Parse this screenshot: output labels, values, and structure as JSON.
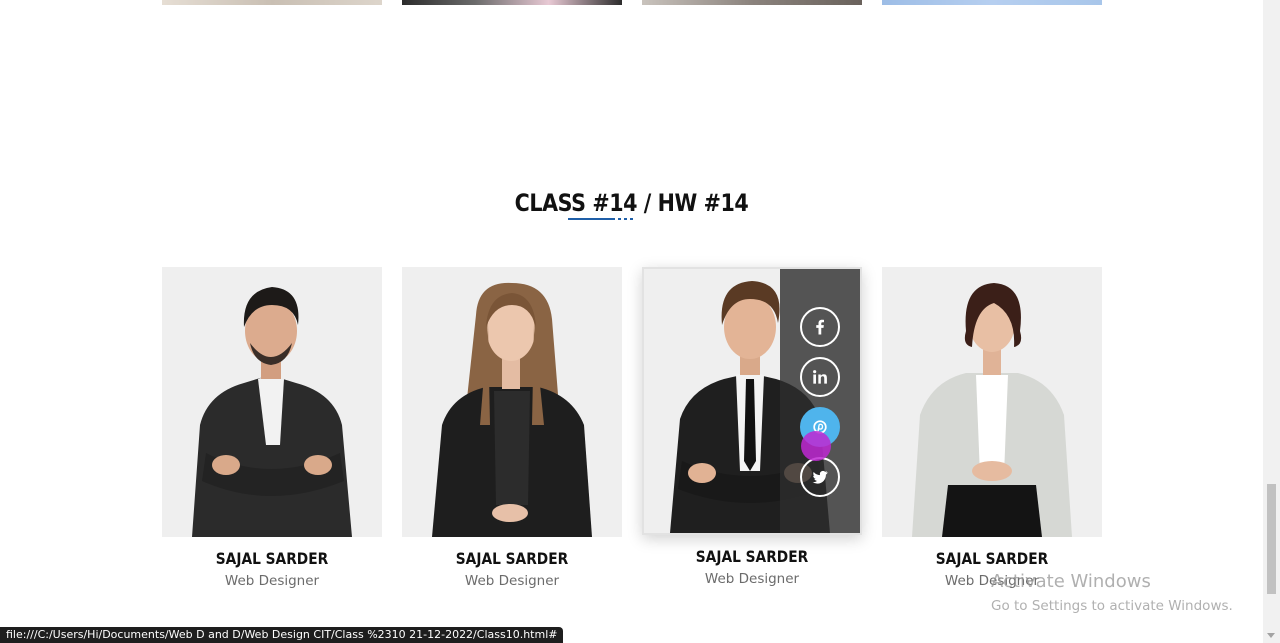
{
  "top_gallery": {
    "thumbs": [
      {
        "color": "#d8d0c6"
      },
      {
        "color": "#3a3a3a"
      },
      {
        "color": "#8a827c"
      },
      {
        "color": "#a8c6ea"
      }
    ]
  },
  "section": {
    "title": "CLASS #14 / HW #14"
  },
  "team": [
    {
      "name": "SAJAL SARDER",
      "role": "Web Designer"
    },
    {
      "name": "SAJAL SARDER",
      "role": "Web Designer"
    },
    {
      "name": "SAJAL SARDER",
      "role": "Web Designer"
    },
    {
      "name": "SAJAL SARDER",
      "role": "Web Designer"
    }
  ],
  "social": {
    "buttons": [
      {
        "icon": "facebook-icon"
      },
      {
        "icon": "linkedin-icon"
      },
      {
        "icon": "pinterest-icon"
      },
      {
        "icon": "twitter-icon"
      }
    ],
    "active_color": "#4fb4ec"
  },
  "watermark": {
    "title": "Activate Windows",
    "subtitle": "Go to Settings to activate Windows."
  },
  "status_bar": {
    "url": "file:///C:/Users/Hi/Documents/Web D and D/Web Design CIT/Class %2310 21-12-2022/Class10.html#"
  }
}
